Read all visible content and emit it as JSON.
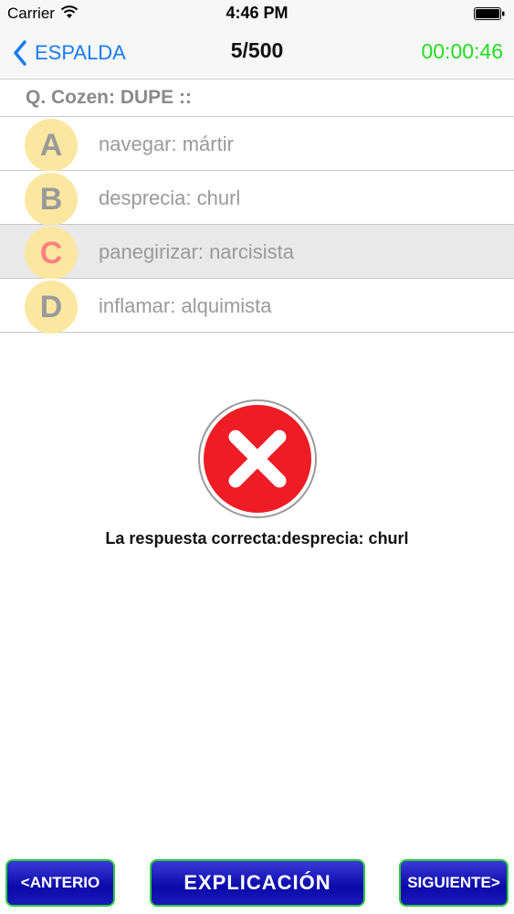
{
  "status_bar": {
    "carrier": "Carrier",
    "time": "4:46 PM",
    "wifi_icon": "wifi-icon",
    "battery_icon": "battery-icon"
  },
  "nav": {
    "back_label": "ESPALDA",
    "progress": "5/500",
    "timer": "00:00:46",
    "back_color": "#1a7bf2",
    "timer_color": "#22dd22"
  },
  "question": {
    "text": "Q. Cozen: DUPE ::"
  },
  "options": [
    {
      "letter": "A",
      "text": "navegar: mártir"
    },
    {
      "letter": "B",
      "text": "desprecia: churl"
    },
    {
      "letter": "C",
      "text": "panegirizar: narcisista"
    },
    {
      "letter": "D",
      "text": "inflamar: alquimista"
    }
  ],
  "selected_option": "C",
  "result": {
    "icon": "wrong-x-icon",
    "text": "La respuesta correcta:desprecia: churl"
  },
  "buttons": {
    "prev": "<ANTERIO",
    "explain": "EXPLICACIÓN",
    "next": "SIGUIENTE>"
  }
}
